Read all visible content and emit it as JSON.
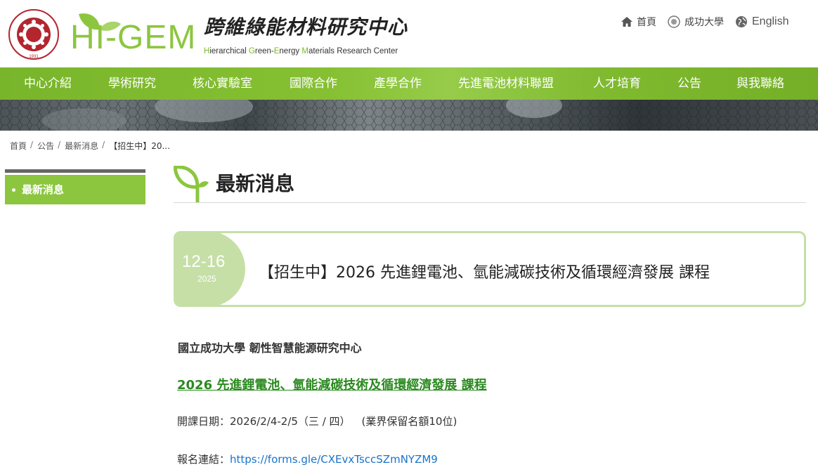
{
  "header": {
    "logo_text": "HI-GEM",
    "center_name_zh": "跨維綠能材料研究中心",
    "center_name_en_parts": [
      {
        "t": "H",
        "g": true
      },
      {
        "t": "ierarchical ",
        "g": false
      },
      {
        "t": "G",
        "g": true
      },
      {
        "t": "reen-",
        "g": false
      },
      {
        "t": "E",
        "g": true
      },
      {
        "t": "nergy ",
        "g": false
      },
      {
        "t": "M",
        "g": true
      },
      {
        "t": "aterials Research Center",
        "g": false
      }
    ],
    "seal_year": "1931",
    "seal_text": "NATIONAL CHENG KUNG UNIVERSITY"
  },
  "toplinks": {
    "home": "首頁",
    "ncku": "成功大學",
    "english": "English"
  },
  "nav": {
    "items": [
      "中心介紹",
      "學術研究",
      "核心實驗室",
      "國際合作",
      "產學合作",
      "先進電池材料聯盟",
      "人才培育",
      "公告",
      "與我聯絡"
    ]
  },
  "breadcrumb": {
    "items": [
      "首頁",
      "公告",
      "最新消息"
    ],
    "current": "【招生中】20..."
  },
  "sidebar": {
    "active_item": "最新消息"
  },
  "page": {
    "title": "最新消息"
  },
  "article": {
    "date_md": "12-16",
    "date_year": "2025",
    "title": "【招生中】2026 先進鋰電池、氫能減碳技術及循環經濟發展 課程",
    "org": "國立成功大學 韌性智慧能源研究中心",
    "course": "2026 先進鋰電池、氫能減碳技術及循環經濟發展 課程",
    "date_label": "開課日期：2026/2/4-2/5（三 / 四）",
    "date_note": "(業界保留名額10位)",
    "link_label": "報名連結：",
    "link_url": "https://forms.gle/CXEvxTsccSZmNYZM9"
  },
  "colors": {
    "brand_green": "#8cc63f",
    "card_green": "#c5dfa6",
    "link_green": "#2a8a1f",
    "link_blue": "#1a73c8",
    "seal_red": "#b3262e"
  }
}
